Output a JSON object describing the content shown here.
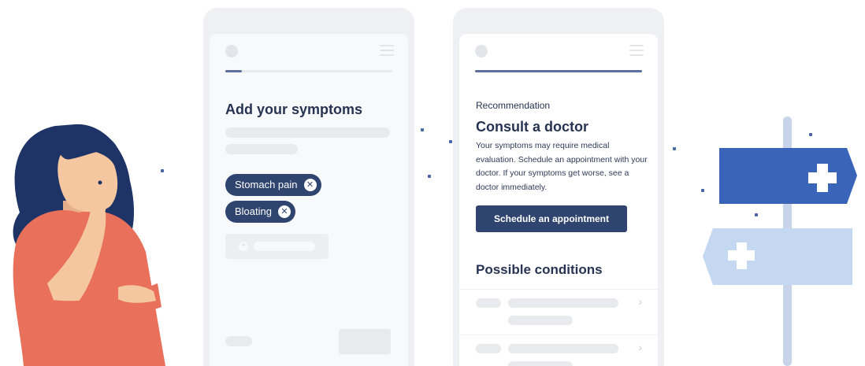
{
  "colors": {
    "navy": "#2f446e",
    "accent": "#5c6f9e",
    "sign_dark": "#3a64b8",
    "sign_light": "#c5d8f2",
    "skin": "#f5c7a0",
    "shirt": "#e9705a",
    "hair": "#1e3366"
  },
  "left_screen": {
    "title": "Add your symptoms",
    "progress": 0.1,
    "symptom_chips": [
      {
        "label": "Stomach pain",
        "remove_icon": "close-circle-icon"
      },
      {
        "label": "Bloating",
        "remove_icon": "close-circle-icon"
      }
    ],
    "add_symptom_icon": "plus-circle-icon"
  },
  "right_screen": {
    "progress": 1.0,
    "section_label": "Recommendation",
    "title": "Consult a doctor",
    "body": "Your symptoms may require medical evaluation. Schedule an appointment with your doctor. If your symptoms get worse, see a doctor immediately.",
    "primary_button": "Schedule an appointment",
    "conditions_title": "Possible conditions",
    "condition_rows": [
      {
        "chevron": "›"
      },
      {
        "chevron": "›"
      }
    ]
  },
  "illustrations": {
    "left": "thinking-woman",
    "right": "signpost-with-medical-crosses"
  }
}
